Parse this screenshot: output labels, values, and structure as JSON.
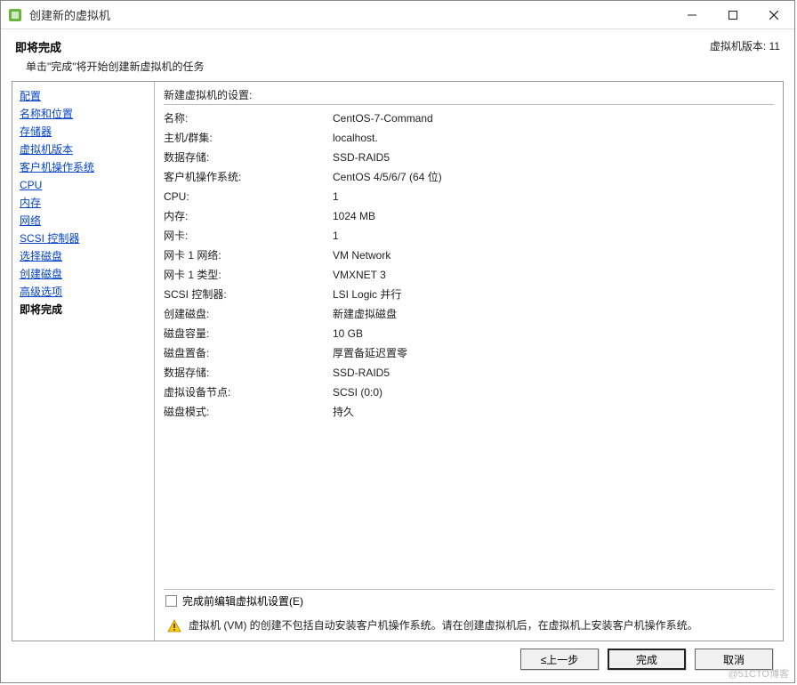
{
  "window": {
    "title": "创建新的虚拟机",
    "version_label": "虚拟机版本: 11"
  },
  "header": {
    "title": "即将完成",
    "subtitle": "单击\"完成\"将开始创建新虚拟机的任务"
  },
  "sidebar": {
    "items": [
      "配置",
      "名称和位置",
      "存储器",
      "虚拟机版本",
      "客户机操作系统",
      "CPU",
      "内存",
      "网络",
      "SCSI 控制器",
      "选择磁盘",
      "创建磁盘",
      "高级选项",
      "即将完成"
    ],
    "current_index": 12
  },
  "main": {
    "settings_title": "新建虚拟机的设置:",
    "rows": [
      {
        "label": "名称:",
        "value": "CentOS-7-Command"
      },
      {
        "label": "主机/群集:",
        "value": "localhost."
      },
      {
        "label": "数据存储:",
        "value": "SSD-RAID5"
      },
      {
        "label": "客户机操作系统:",
        "value": "CentOS 4/5/6/7 (64 位)"
      },
      {
        "label": "CPU:",
        "value": "1"
      },
      {
        "label": "内存:",
        "value": "1024 MB"
      },
      {
        "label": "网卡:",
        "value": "1"
      },
      {
        "label": "网卡 1 网络:",
        "value": "VM Network"
      },
      {
        "label": "网卡 1 类型:",
        "value": "VMXNET 3"
      },
      {
        "label": "SCSI 控制器:",
        "value": "LSI Logic 并行"
      },
      {
        "label": "创建磁盘:",
        "value": "新建虚拟磁盘"
      },
      {
        "label": "磁盘容量:",
        "value": "10 GB"
      },
      {
        "label": "磁盘置备:",
        "value": "厚置备延迟置零"
      },
      {
        "label": "数据存储:",
        "value": "SSD-RAID5"
      },
      {
        "label": "虚拟设备节点:",
        "value": "SCSI (0:0)"
      },
      {
        "label": "磁盘模式:",
        "value": "持久"
      }
    ],
    "checkbox_label": "完成前编辑虚拟机设置(E)",
    "warning_text": "虚拟机 (VM) 的创建不包括自动安装客户机操作系统。请在创建虚拟机后，在虚拟机上安装客户机操作系统。"
  },
  "buttons": {
    "back": "≤上一步",
    "finish": "完成",
    "cancel": "取消"
  },
  "watermark": "@51CTO博客"
}
